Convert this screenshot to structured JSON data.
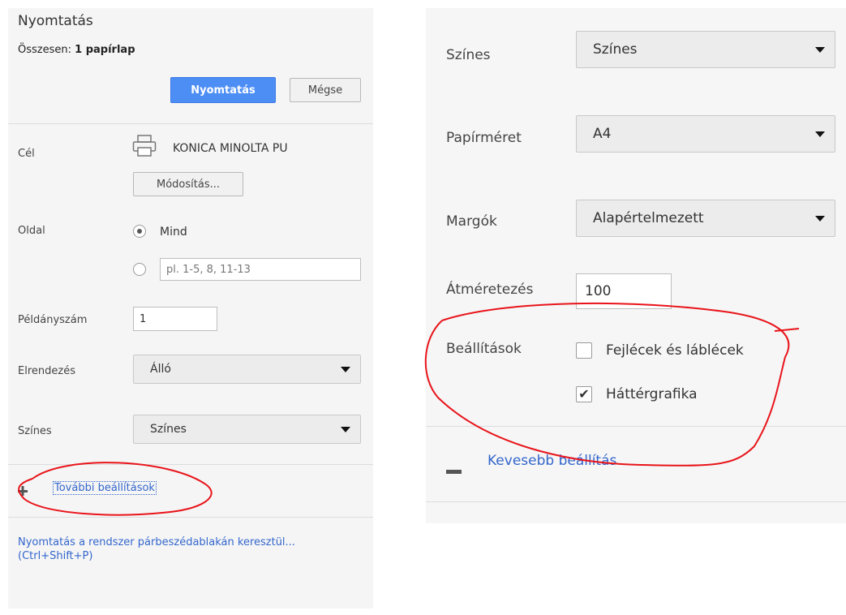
{
  "left_panel": {
    "title": "Nyomtatás",
    "total_label": "Összesen:",
    "total_value": "1 papírlap",
    "print_button": "Nyomtatás",
    "cancel_button": "Mégse",
    "destination": {
      "label": "Cél",
      "printer_name": "KONICA MINOLTA PU",
      "change_button": "Módosítás..."
    },
    "pages": {
      "label": "Oldal",
      "all_option": "Mind",
      "custom_placeholder": "pl. 1-5, 8, 11-13"
    },
    "copies": {
      "label": "Példányszám",
      "value": "1"
    },
    "layout": {
      "label": "Elrendezés",
      "value": "Álló"
    },
    "color": {
      "label": "Színes",
      "value": "Színes"
    },
    "more_settings_link": "További beállítások",
    "system_dialog_link": "Nyomtatás a rendszer párbeszédablakán keresztül... (Ctrl+Shift+P)"
  },
  "right_panel": {
    "color": {
      "label": "Színes",
      "value": "Színes"
    },
    "paper_size": {
      "label": "Papírméret",
      "value": "A4"
    },
    "margins": {
      "label": "Margók",
      "value": "Alapértelmezett"
    },
    "scale": {
      "label": "Átméretezés",
      "value": "100"
    },
    "options": {
      "label": "Beállítások",
      "headers_footers": {
        "label": "Fejlécek és láblécek",
        "checked": false
      },
      "background_graphics": {
        "label": "Háttérgrafika",
        "checked": true
      }
    },
    "fewer_settings_link": "Kevesebb beállítás"
  },
  "colors": {
    "accent": "#4d8ef5",
    "link": "#3366cc",
    "annotation": "#e8141a"
  }
}
